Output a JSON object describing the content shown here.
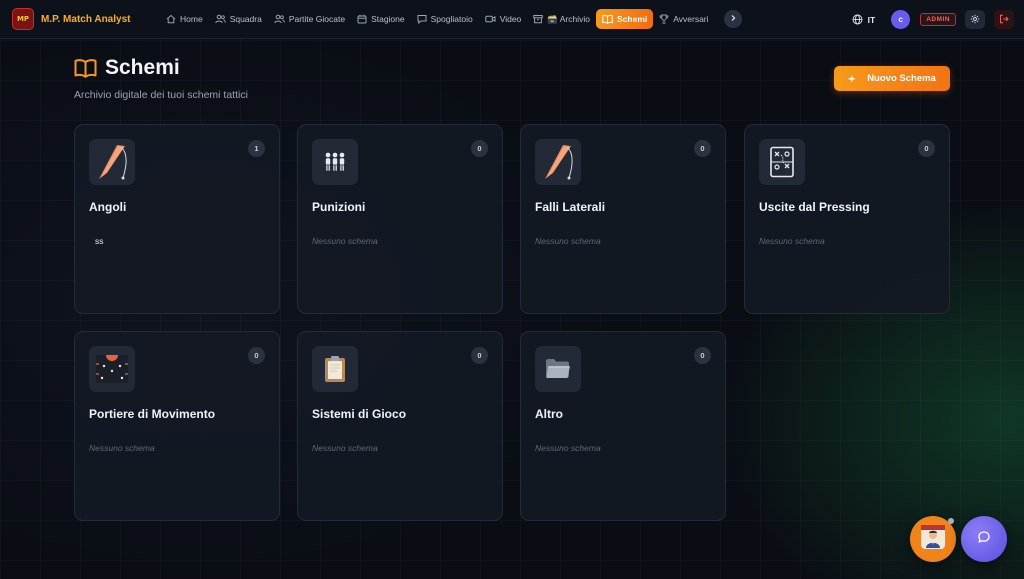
{
  "app": {
    "brand_name": "M.P. Match Analyst",
    "logo_text": "MP"
  },
  "nav": {
    "items": [
      {
        "label": "Home",
        "icon": "home-icon"
      },
      {
        "label": "Squadra",
        "icon": "users-icon"
      },
      {
        "label": "Partite Giocate",
        "icon": "users-icon"
      },
      {
        "label": "Stagione",
        "icon": "calendar-icon"
      },
      {
        "label": "Spogliatoio",
        "icon": "chat-icon"
      },
      {
        "label": "Video",
        "icon": "video-icon"
      },
      {
        "label": "🗃️ Archivio",
        "icon": "archive-icon"
      },
      {
        "label": "Schemi",
        "icon": "book-icon",
        "active": true
      },
      {
        "label": "Avversari",
        "icon": "trophy-icon"
      }
    ],
    "more_icon": "chevron-right-icon",
    "language": "IT",
    "user_initial": "c",
    "admin_badge": "ADMIN"
  },
  "header": {
    "title": "Schemi",
    "subtitle": "Archivio digitale dei tuoi schemi tattici",
    "new_button": "Nuovo Schema",
    "new_button_icon": "+"
  },
  "categories": [
    {
      "title": "Angoli",
      "count": "1",
      "icon": "corner-flag-icon",
      "items": [
        "ss"
      ],
      "empty_text": ""
    },
    {
      "title": "Punizioni",
      "count": "0",
      "icon": "wall-players-icon",
      "items": [],
      "empty_text": "Nessuno schema"
    },
    {
      "title": "Falli Laterali",
      "count": "0",
      "icon": "corner-flag-icon",
      "items": [],
      "empty_text": "Nessuno schema"
    },
    {
      "title": "Uscite dal Pressing",
      "count": "0",
      "icon": "tactics-board-icon",
      "items": [],
      "empty_text": "Nessuno schema"
    },
    {
      "title": "Portiere di Movimento",
      "count": "0",
      "icon": "goalkeeper-pitch-icon",
      "items": [],
      "empty_text": "Nessuno schema"
    },
    {
      "title": "Sistemi di Gioco",
      "count": "0",
      "icon": "clipboard-icon",
      "items": [],
      "empty_text": "Nessuno schema"
    },
    {
      "title": "Altro",
      "count": "0",
      "icon": "folder-icon",
      "items": [],
      "empty_text": "Nessuno schema"
    }
  ],
  "colors": {
    "accent": "#f79a1a",
    "brand": "#f5b324",
    "admin": "#ff5a5a",
    "avatar": "#6a5cf0",
    "chat_fab": "#6a5cf0"
  },
  "fabs": {
    "coach_icon": "coach-avatar-icon",
    "chat_icon": "chat-bubble-icon"
  }
}
